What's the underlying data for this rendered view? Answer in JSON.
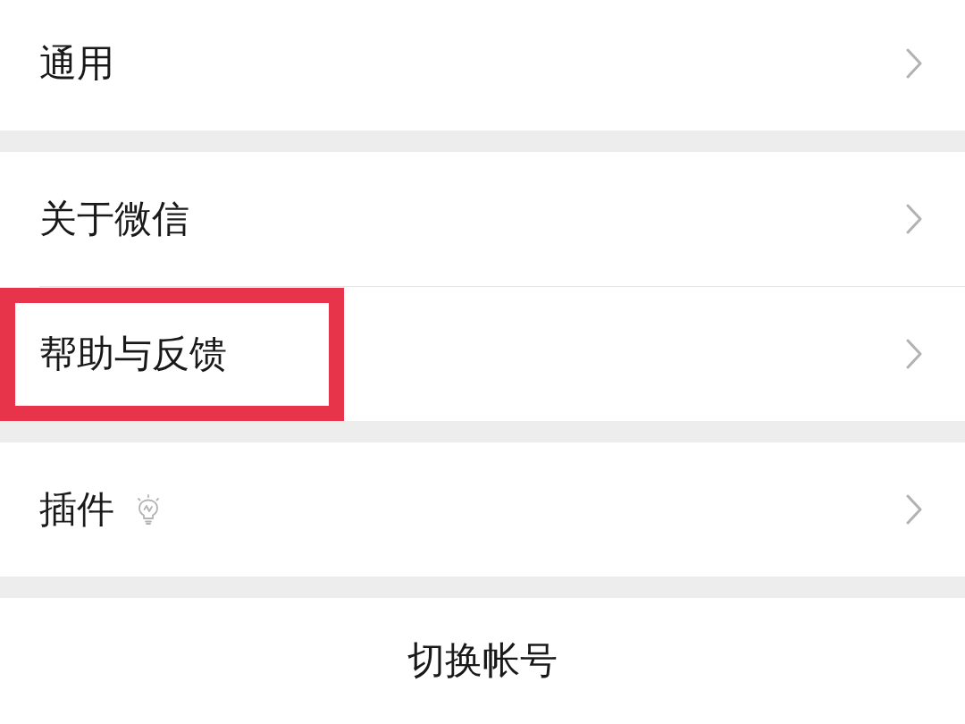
{
  "groups": [
    {
      "items": [
        {
          "label": "通用",
          "hint_icon": false,
          "highlighted": false
        }
      ]
    },
    {
      "items": [
        {
          "label": "关于微信",
          "hint_icon": false,
          "highlighted": false
        },
        {
          "label": "帮助与反馈",
          "hint_icon": false,
          "highlighted": true
        }
      ]
    },
    {
      "items": [
        {
          "label": "插件",
          "hint_icon": true,
          "highlighted": false
        }
      ]
    }
  ],
  "switch_account": {
    "label": "切换帐号"
  }
}
